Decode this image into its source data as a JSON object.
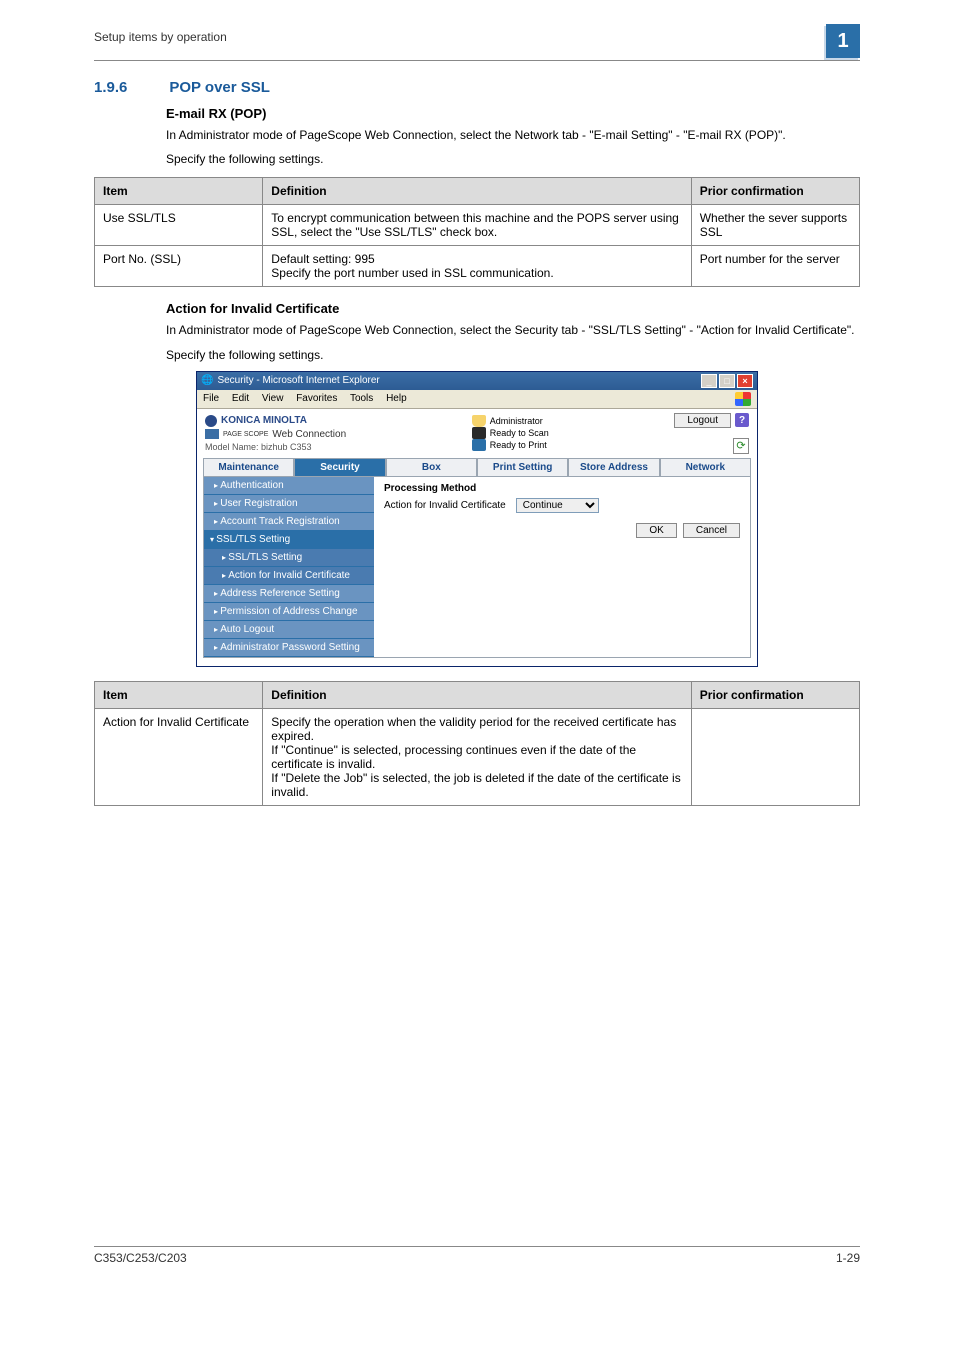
{
  "page": {
    "breadcrumb": "Setup items by operation",
    "chapter_badge": "1",
    "section_number": "1.9.6",
    "section_title": "POP over SSL",
    "footer_model": "C353/C253/C203",
    "footer_page": "1-29"
  },
  "sub1": {
    "heading": "E-mail RX (POP)",
    "para1": "In Administrator mode of PageScope Web Connection, select the Network tab - \"E-mail Setting\" - \"E-mail RX (POP)\".",
    "para2": "Specify the following settings."
  },
  "table1": {
    "headers": {
      "item": "Item",
      "def": "Definition",
      "prior": "Prior confirmation"
    },
    "rows": [
      {
        "item": "Use SSL/TLS",
        "def": "To encrypt communication between this machine and the POPS server using SSL, select the \"Use SSL/TLS\" check box.",
        "prior": "Whether the sever supports SSL"
      },
      {
        "item": "Port No. (SSL)",
        "def": "Default setting: 995\nSpecify the port number used in SSL communication.",
        "prior": "Port number for the server"
      }
    ]
  },
  "sub2": {
    "heading": "Action for Invalid Certificate",
    "para1": "In Administrator mode of PageScope Web Connection, select the Security tab - \"SSL/TLS Setting\" - \"Action for Invalid Certificate\".",
    "para2": "Specify the following settings."
  },
  "ie": {
    "title": "Security - Microsoft Internet Explorer",
    "menus": {
      "file": "File",
      "edit": "Edit",
      "view": "View",
      "favorites": "Favorites",
      "tools": "Tools",
      "help": "Help"
    },
    "brand": "KONICA MINOLTA",
    "websub": "Web Connection",
    "websub_prefix": "PAGE SCOPE",
    "model": "Model Name: bizhub C353",
    "admin_label": "Administrator",
    "ready_scan": "Ready to Scan",
    "ready_print": "Ready to Print",
    "logout": "Logout",
    "tabs": {
      "maint": "Maintenance",
      "sec": "Security",
      "box": "Box",
      "print": "Print Setting",
      "store": "Store Address",
      "net": "Network"
    },
    "side": {
      "auth": "Authentication",
      "ureg": "User Registration",
      "atrack": "Account Track Registration",
      "ssl": "SSL/TLS Setting",
      "ssl_sub": "SSL/TLS Setting",
      "action_inv": "Action for Invalid Certificate",
      "addr_ref": "Address Reference Setting",
      "perm_addr": "Permission of Address Change",
      "autolog": "Auto Logout",
      "adminpw": "Administrator Password Setting"
    },
    "main": {
      "pm_title": "Processing Method",
      "aic_label": "Action for Invalid Certificate",
      "aic_value": "Continue",
      "ok": "OK",
      "cancel": "Cancel"
    }
  },
  "table2": {
    "headers": {
      "item": "Item",
      "def": "Definition",
      "prior": "Prior confirmation"
    },
    "rows": [
      {
        "item": "Action for Invalid Certificate",
        "def": "Specify the operation when the validity period for the received certificate has expired.\nIf \"Continue\" is selected, processing continues even if the date of the certificate is invalid.\nIf \"Delete the Job\" is selected, the job is deleted if the date of the certificate is invalid.",
        "prior": ""
      }
    ]
  }
}
